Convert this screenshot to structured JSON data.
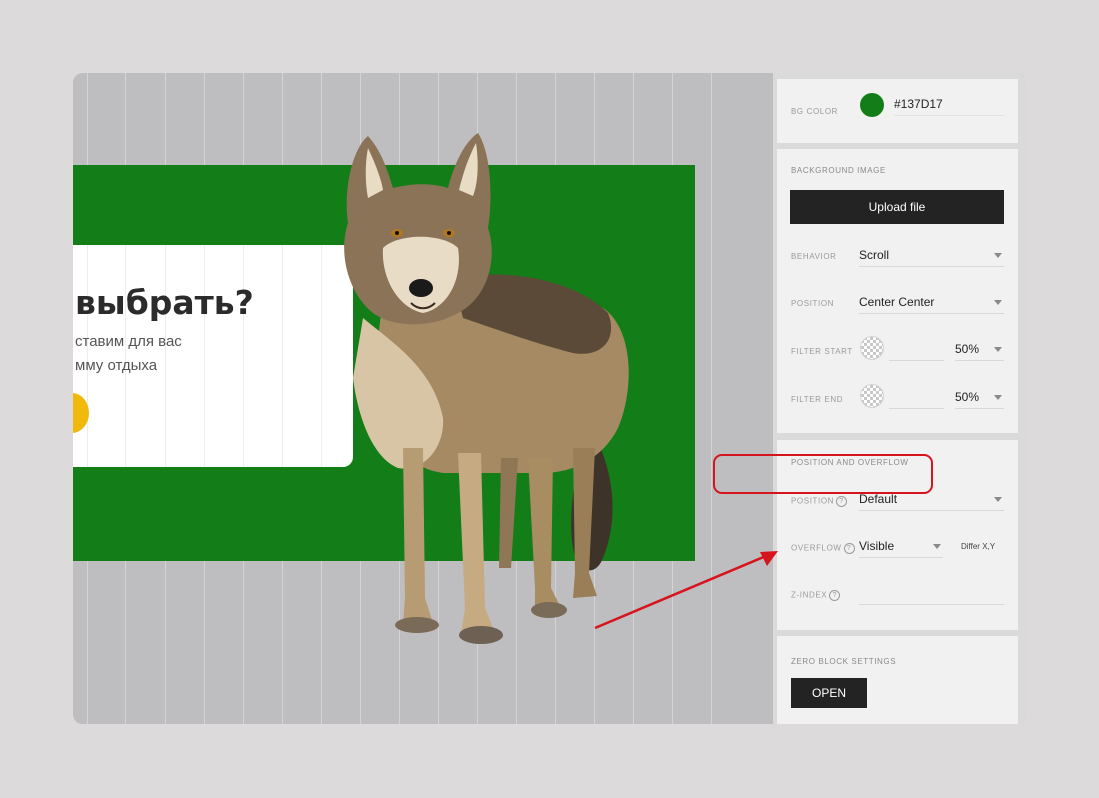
{
  "canvas": {
    "heading": "выбрать?",
    "text_line1": "ставим для вас",
    "text_line2": "мму отдыха",
    "block_color": "#137D17",
    "accent_color": "#f2b90d",
    "image": "wolf-photo"
  },
  "panel": {
    "bg_color": {
      "label": "BG COLOR",
      "value": "#137D17",
      "swatch": "#137D17"
    },
    "background_image": {
      "title": "BACKGROUND IMAGE",
      "upload_label": "Upload file",
      "behavior_label": "BEHAVIOR",
      "behavior_value": "Scroll",
      "position_label": "POSITION",
      "position_value": "Center Center",
      "filter_start_label": "FILTER START",
      "filter_start_value": "50%",
      "filter_end_label": "FILTER END",
      "filter_end_value": "50%"
    },
    "position_overflow": {
      "title": "POSITION AND OVERFLOW",
      "position_label": "POSITION",
      "position_value": "Default",
      "overflow_label": "OVERFLOW",
      "overflow_value": "Visible",
      "differ_label": "Differ X,Y",
      "zindex_label": "Z-INDEX",
      "help_glyph": "?"
    },
    "zero_block": {
      "title": "ZERO BLOCK SETTINGS",
      "open_label": "OPEN"
    }
  },
  "annotation": {
    "color": "#d6141d"
  }
}
